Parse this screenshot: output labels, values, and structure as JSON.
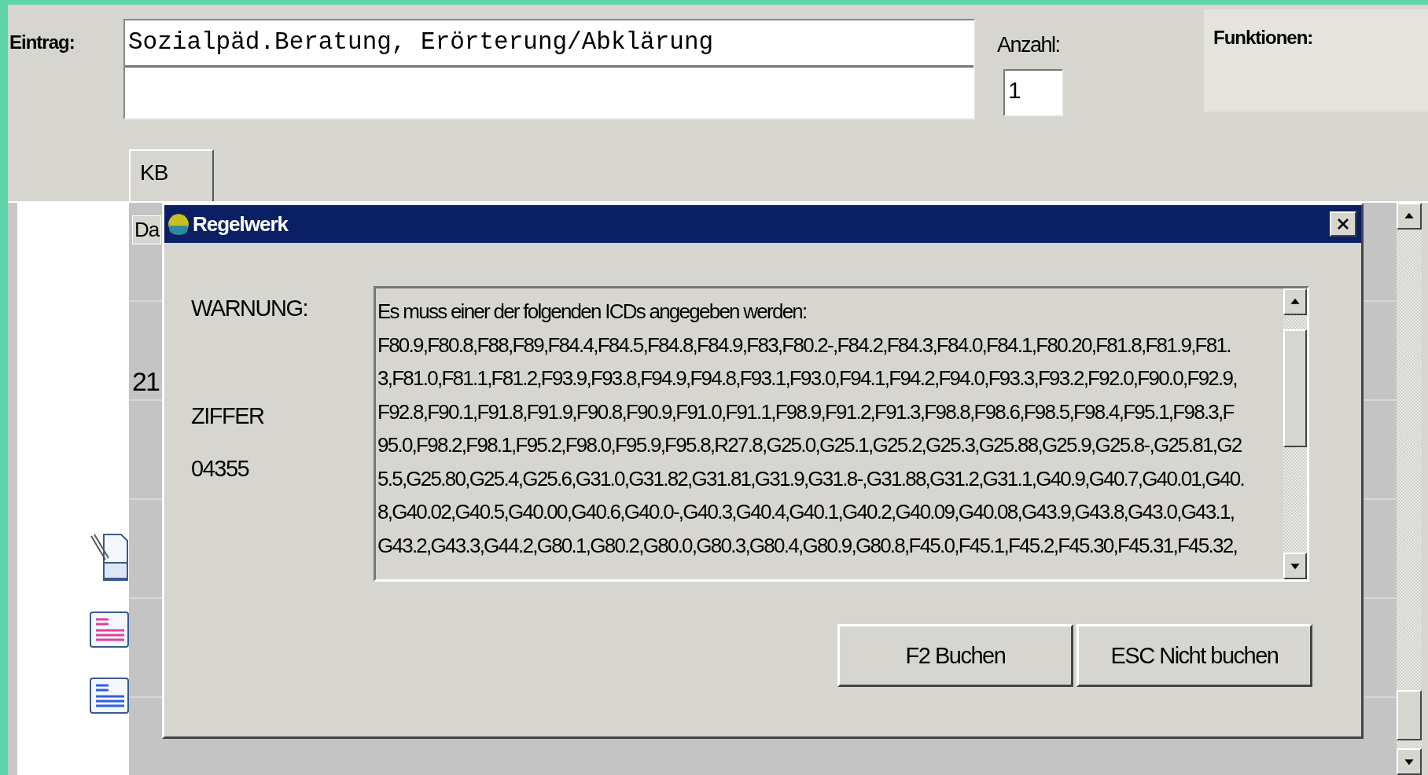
{
  "form": {
    "entry_label": "Eintrag:",
    "entry_value": "Sozialpäd.Beratung, Erörterung/Abklärung",
    "count_label": "Anzahl:",
    "count_value": "1",
    "functions_label": "Funktionen:"
  },
  "tabs": [
    {
      "label": "KB",
      "selected": true
    }
  ],
  "background": {
    "column_header": "Da",
    "row_value": "21"
  },
  "dialog": {
    "title": "Regelwerk",
    "warning_label": "WARNUNG:",
    "number_label": "ZIFFER",
    "number_value": "04355",
    "message_lines": [
      "Es muss einer der folgenden ICDs angegeben werden:",
      "F80.9,F80.8,F88,F89,F84.4,F84.5,F84.8,F84.9,F83,F80.2-,F84.2,F84.3,F84.0,F84.1,F80.20,F81.8,F81.9,F81.",
      "3,F81.0,F81.1,F81.2,F93.9,F93.8,F94.9,F94.8,F93.1,F93.0,F94.1,F94.2,F94.0,F93.3,F93.2,F92.0,F90.0,F92.9,",
      "F92.8,F90.1,F91.8,F91.9,F90.8,F90.9,F91.0,F91.1,F98.9,F91.2,F91.3,F98.8,F98.6,F98.5,F98.4,F95.1,F98.3,F",
      "95.0,F98.2,F98.1,F95.2,F98.0,F95.9,F95.8,R27.8,G25.0,G25.1,G25.2,G25.3,G25.88,G25.9,G25.8-,G25.81,G2",
      "5.5,G25.80,G25.4,G25.6,G31.0,G31.82,G31.81,G31.9,G31.8-,G31.88,G31.2,G31.1,G40.9,G40.7,G40.01,G40.",
      "8,G40.02,G40.5,G40.00,G40.6,G40.0-,G40.3,G40.4,G40.1,G40.2,G40.09,G40.08,G43.9,G43.8,G43.0,G43.1,",
      "G43.2,G43.3,G44.2,G80.1,G80.2,G80.0,G80.3,G80.4,G80.9,G80.8,F45.0,F45.1,F45.2,F45.30,F45.31,F45.32,"
    ],
    "buttons": [
      "F2 Buchen",
      "ESC Nicht buchen"
    ]
  }
}
